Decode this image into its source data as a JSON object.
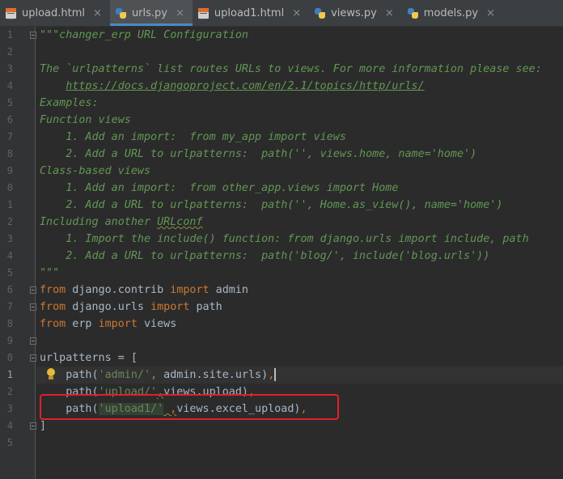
{
  "tabs": [
    {
      "label": "upload.html",
      "icon": "html-file-icon",
      "active": false
    },
    {
      "label": "urls.py",
      "icon": "python-file-icon",
      "active": true
    },
    {
      "label": "upload1.html",
      "icon": "html-file-icon",
      "active": false
    },
    {
      "label": "views.py",
      "icon": "python-file-icon",
      "active": false
    },
    {
      "label": "models.py",
      "icon": "python-file-icon",
      "active": false
    }
  ],
  "close_glyph": "×",
  "line_numbers": [
    "1",
    "2",
    "3",
    "4",
    "5",
    "6",
    "7",
    "8",
    "9",
    "0",
    "1",
    "2",
    "3",
    "4",
    "5",
    "6",
    "7",
    "8",
    "9",
    "0",
    "1",
    "2",
    "3",
    "4",
    "5"
  ],
  "colors": {
    "background": "#2b2b2b",
    "docstring": "#629755",
    "keyword": "#cc7832",
    "string": "#6a8759",
    "identifier": "#a9b7c6",
    "annotation_box": "#e0202a",
    "active_tab_underline": "#4a88c7"
  },
  "code": {
    "l1": "\"\"\"changer_erp URL Configuration",
    "l3": "The `urlpatterns` list routes URLs to views. For more information please see:",
    "l4": "https://docs.djangoproject.com/en/2.1/topics/http/urls/",
    "l5": "Examples:",
    "l6": "Function views",
    "l7": "    1. Add an import:  from my_app import views",
    "l8": "    2. Add a URL to urlpatterns:  path('', views.home, name='home')",
    "l9": "Class-based views",
    "l10": "    1. Add an import:  from other_app.views import Home",
    "l11": "    2. Add a URL to urlpatterns:  path('', Home.as_view(), name='home')",
    "l12a": "Including another ",
    "l12b": "URLconf",
    "l13": "    1. Import the include() function: from django.urls import include, path",
    "l14": "    2. Add a URL to urlpatterns:  path('blog/', include('blog.urls'))",
    "l15": "\"\"\"",
    "l16": {
      "kw1": "from",
      "mod": " django.contrib ",
      "kw2": "import",
      "name": " admin"
    },
    "l17": {
      "kw1": "from",
      "mod": " django.urls ",
      "kw2": "import",
      "name": " path"
    },
    "l18": {
      "kw1": "from",
      "mod": " erp ",
      "kw2": "import",
      "name": " views"
    },
    "l20": "urlpatterns = [",
    "l21": {
      "pre": "    path(",
      "str": "'admin/'",
      "comma": ",",
      "rest": " admin.site.urls)",
      "end": ","
    },
    "l22": {
      "pre": "    path(",
      "str": "'upload/'",
      "comma": ",",
      "rest": "views.upload)",
      "end": ","
    },
    "l23": {
      "pre": "    path(",
      "str": "'upload1/'",
      "comma": " ,",
      "rest": "views.excel_upload)",
      "end": ","
    },
    "l24": "]"
  }
}
